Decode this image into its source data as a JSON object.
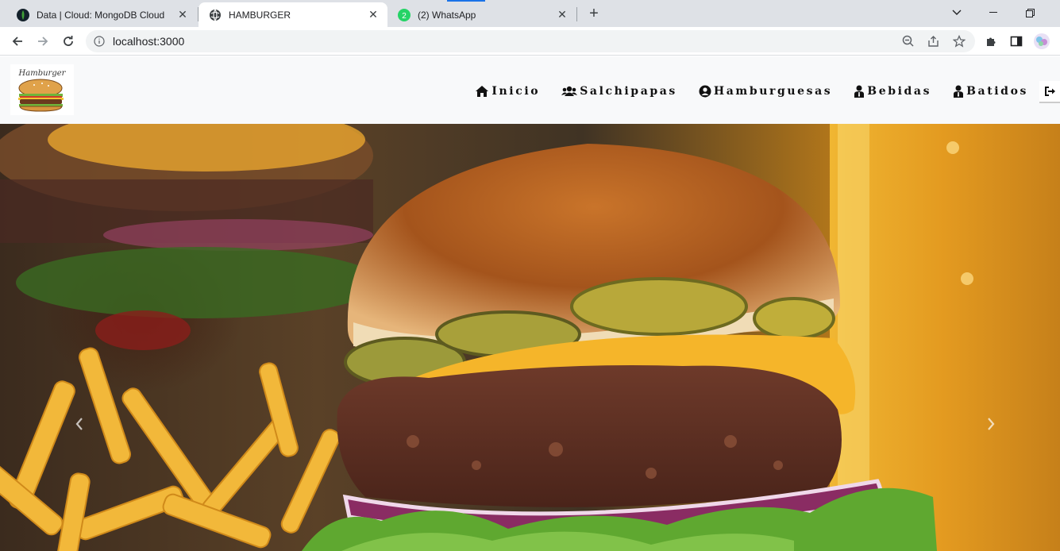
{
  "browser": {
    "tabs": [
      {
        "title": "Data | Cloud: MongoDB Cloud",
        "icon": "mongodb-leaf-icon"
      },
      {
        "title": "HAMBURGER",
        "icon": "globe-icon",
        "active": true
      },
      {
        "title": "(2) WhatsApp",
        "icon": "whatsapp-icon",
        "badge": "2"
      }
    ],
    "address": "localhost:3000"
  },
  "site": {
    "nav": [
      {
        "label": "Inicio",
        "icon": "home-icon"
      },
      {
        "label": "Salchipapas",
        "icon": "users-icon"
      },
      {
        "label": "Hamburguesas",
        "icon": "user-circle-icon"
      },
      {
        "label": "Bebidas",
        "icon": "user-tie-icon"
      },
      {
        "label": "Batidos",
        "icon": "user-tie-icon"
      }
    ],
    "logo_alt": "Hamburger",
    "hero": {
      "image": "cheeseburger with fries and beer"
    }
  },
  "colors": {
    "tabstrip": "#dee1e6",
    "navbar": "#f8f9fa",
    "bun": "#d28a3a",
    "cheese": "#f5b52a",
    "lettuce": "#5fa830",
    "onion": "#8a2c63"
  }
}
